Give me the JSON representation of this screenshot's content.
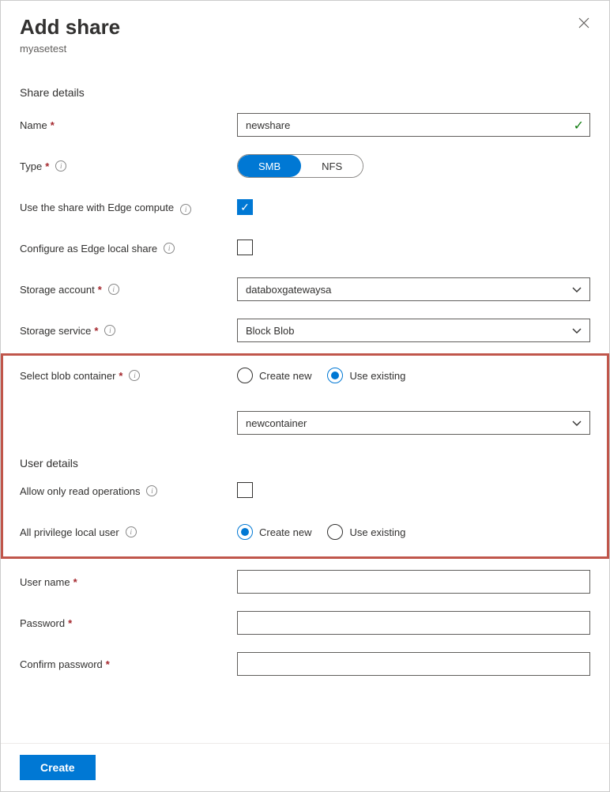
{
  "header": {
    "title": "Add share",
    "subtitle": "myasetest"
  },
  "sections": {
    "share_details": "Share details",
    "user_details": "User details"
  },
  "labels": {
    "name": "Name",
    "type": "Type",
    "use_edge_compute": "Use the share with Edge compute",
    "configure_local": "Configure as Edge local share",
    "storage_account": "Storage account",
    "storage_service": "Storage service",
    "select_blob": "Select blob container",
    "allow_read_only": "Allow only read operations",
    "all_priv_user": "All privilege local user",
    "user_name": "User name",
    "password": "Password",
    "confirm_password": "Confirm password"
  },
  "values": {
    "name": "newshare",
    "storage_account": "databoxgatewaysa",
    "storage_service": "Block Blob",
    "blob_container": "newcontainer",
    "user_name": "",
    "password": "",
    "confirm_password": ""
  },
  "type_options": {
    "smb": "SMB",
    "nfs": "NFS"
  },
  "radio_options": {
    "create_new": "Create new",
    "use_existing": "Use existing"
  },
  "footer": {
    "create": "Create"
  }
}
